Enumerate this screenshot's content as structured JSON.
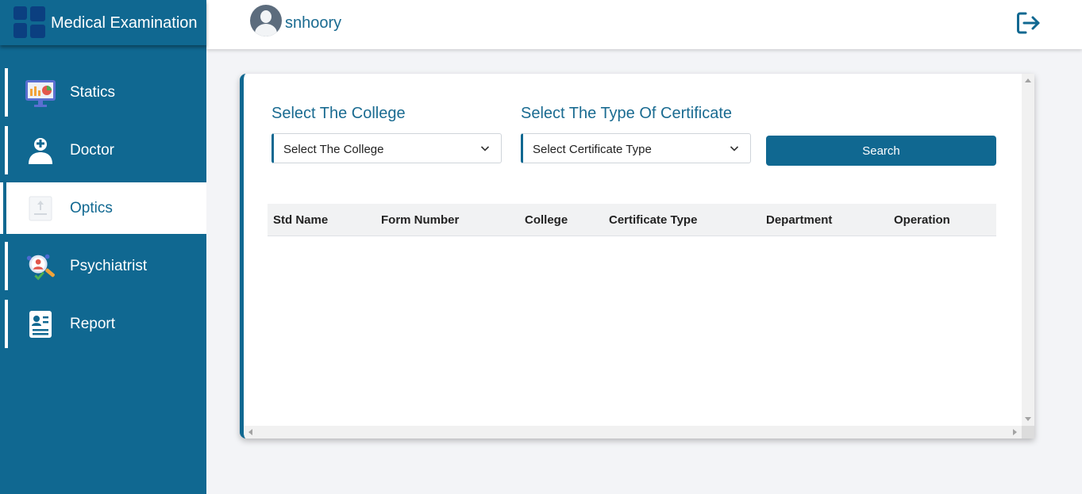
{
  "app": {
    "title": "Medical Examination"
  },
  "header": {
    "username": "snhoory"
  },
  "sidebar": {
    "items": [
      {
        "label": "Statics",
        "icon": "statistics-monitor-icon",
        "active": false
      },
      {
        "label": "Doctor",
        "icon": "doctor-icon",
        "active": false
      },
      {
        "label": "Optics",
        "icon": "optics-icon",
        "active": true
      },
      {
        "label": "Psychiatrist",
        "icon": "psychiatrist-icon",
        "active": false
      },
      {
        "label": "Report",
        "icon": "report-icon",
        "active": false
      }
    ]
  },
  "filters": {
    "college_label": "Select The College",
    "college_selected": "Select The College",
    "certificate_label": "Select The Type Of Certificate",
    "certificate_selected": "Select Certificate Type",
    "search_label": "Search"
  },
  "table": {
    "columns": [
      "Std Name",
      "Form Number",
      "College",
      "Certificate Type",
      "Department",
      "Operation"
    ],
    "rows": []
  },
  "colors": {
    "primary": "#106891",
    "brand_dark": "#0b3f80",
    "background": "#f3f4f7"
  }
}
